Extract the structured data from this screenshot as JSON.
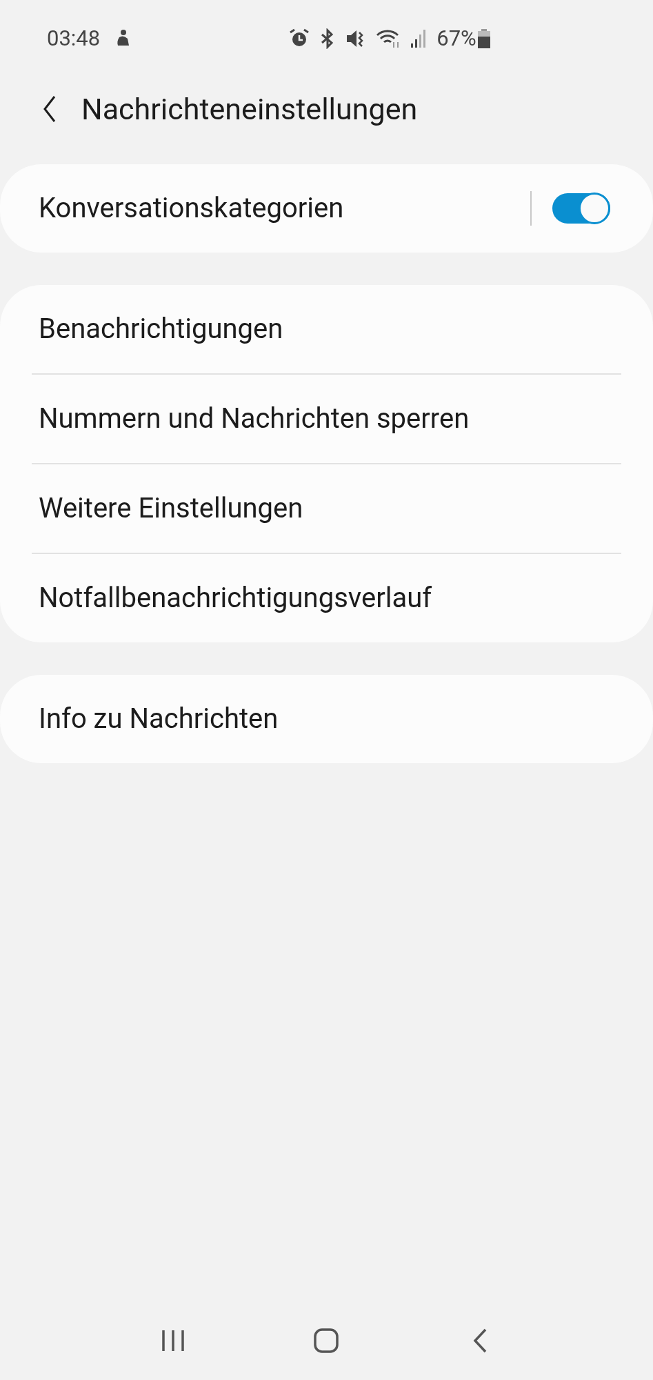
{
  "status_bar": {
    "time": "03:48",
    "battery": "67%"
  },
  "header": {
    "title": "Nachrichteneinstellungen"
  },
  "groups": [
    {
      "items": [
        {
          "kind": "toggle",
          "label": "Konversationskategorien",
          "on": true
        }
      ]
    },
    {
      "items": [
        {
          "kind": "link",
          "label": "Benachrichtigungen"
        },
        {
          "kind": "link",
          "label": "Nummern und Nachrichten sperren"
        },
        {
          "kind": "link",
          "label": "Weitere Einstellungen"
        },
        {
          "kind": "link",
          "label": "Notfallbenachrichtigungsverlauf"
        }
      ]
    },
    {
      "items": [
        {
          "kind": "link",
          "label": "Info zu Nachrichten"
        }
      ]
    }
  ]
}
